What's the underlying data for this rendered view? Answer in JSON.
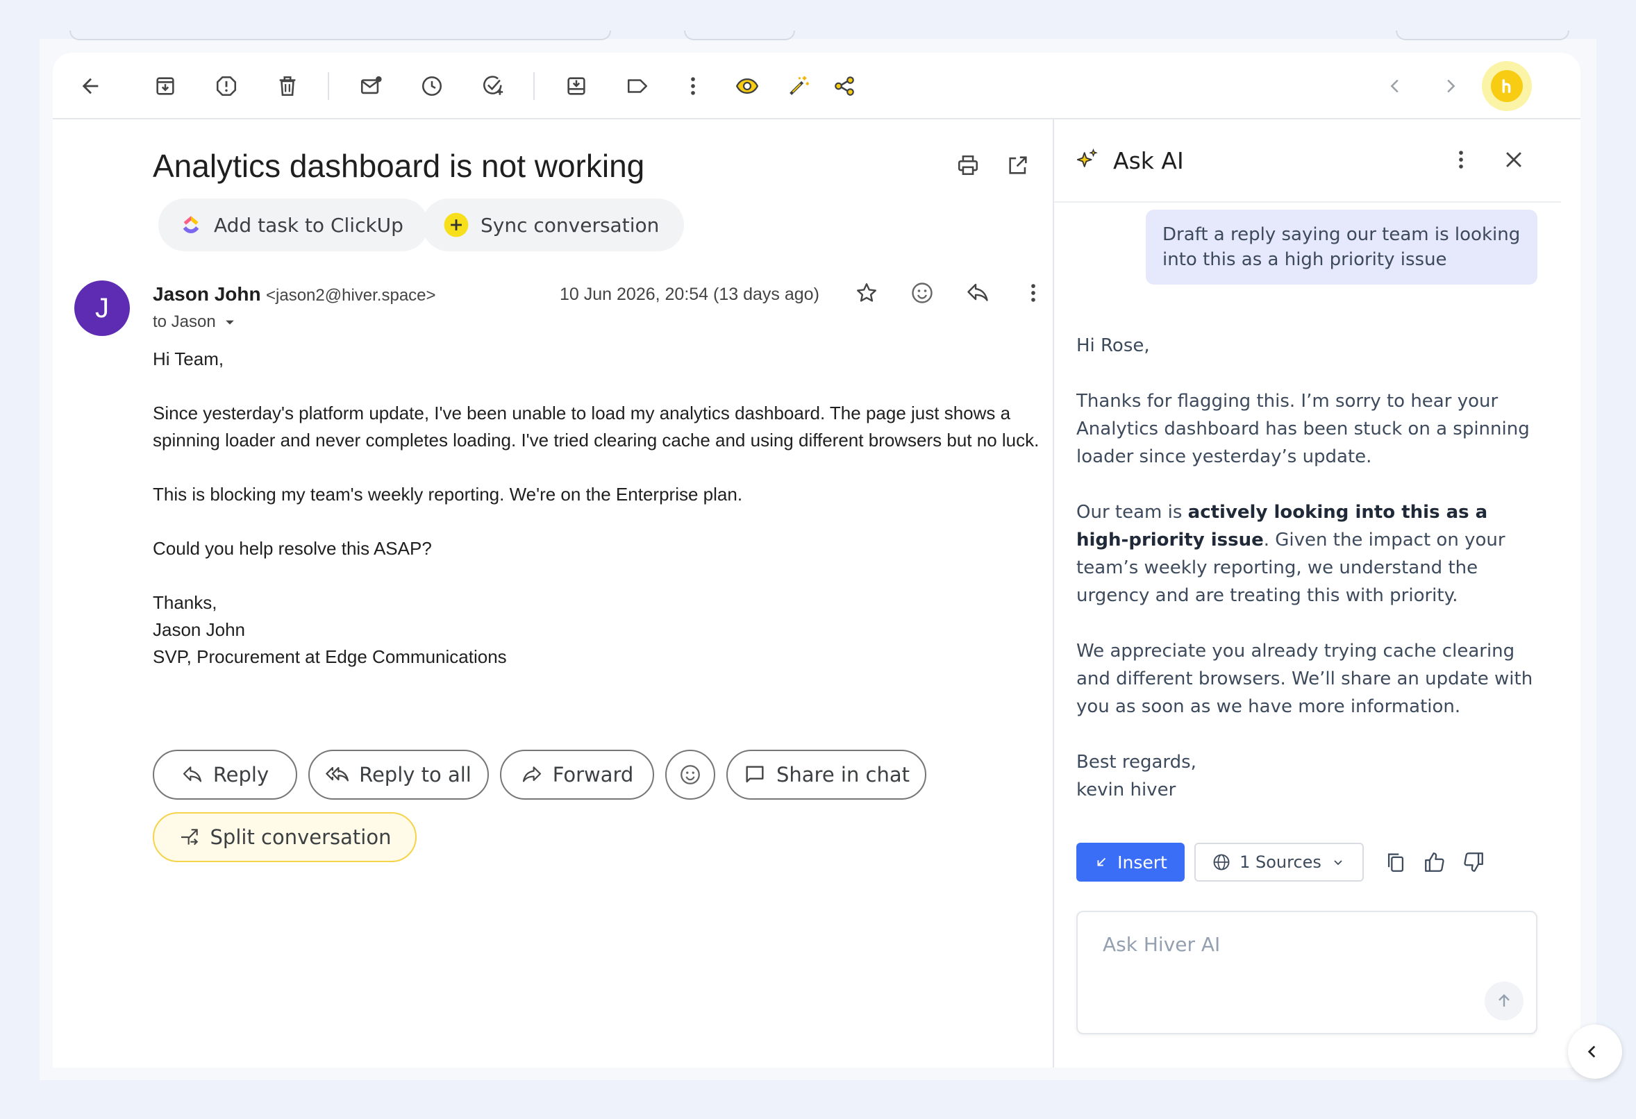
{
  "toolbar": {
    "icons": [
      "back-arrow-icon",
      "archive-icon",
      "report-spam-icon",
      "delete-icon",
      "mark-unread-icon",
      "snooze-icon",
      "add-task-icon",
      "move-to-icon",
      "label-icon",
      "more-vert-icon",
      "eye-icon",
      "magic-wand-icon",
      "share-icon"
    ],
    "nav": [
      "prev-icon",
      "next-icon"
    ]
  },
  "email": {
    "subject": "Analytics dashboard is not working",
    "chips": {
      "clickup": "Add task to ClickUp",
      "sync": "Sync conversation"
    },
    "avatar_letter": "J",
    "sender_name": "Jason John",
    "sender_email": "<jason2@hiver.space>",
    "to": "to Jason",
    "date": "10 Jun 2026, 20:54 (13 days ago)",
    "body": {
      "greeting": "Hi Team,",
      "p1": "Since yesterday's platform update, I've been unable to load my analytics dashboard. The page just shows a spinning loader and never completes loading. I've tried clearing cache and using different browsers but no luck.",
      "p2": "This is blocking my team's weekly reporting. We're on the Enterprise plan.",
      "p3": "Could you help resolve this ASAP?",
      "sign_thanks": "Thanks,",
      "sign_name": "Jason John",
      "sign_title": "SVP, Procurement at Edge Communications"
    },
    "actions": {
      "reply": "Reply",
      "reply_all": "Reply to all",
      "forward": "Forward",
      "share_chat": "Share in chat",
      "split": "Split conversation"
    }
  },
  "ai_panel": {
    "title": "Ask AI",
    "user_prompt": "Draft a reply saying our team is looking into this as a high priority issue",
    "reply": {
      "greeting": "Hi Rose,",
      "p1": "Thanks for flagging this. I’m sorry to hear your Analytics dashboard has been stuck on a spinning loader since yesterday’s update.",
      "p2_pre": "Our team is ",
      "p2_bold": "actively looking into this as a high-priority issue",
      "p2_post": ". Given the impact on your team’s weekly reporting, we understand the urgency and are treating this with priority.",
      "p3": "We appreciate you already trying cache clearing and different browsers. We’ll share an update with you as soon as we have more information.",
      "sign_off": "Best regards,",
      "sign_name": "kevin hiver"
    },
    "insert_label": "Insert",
    "sources_label": "1 Sources",
    "input_placeholder": "Ask Hiver AI"
  },
  "colors": {
    "accent_blue": "#3b6ef6",
    "avatar_purple": "#5e2cb3",
    "hiver_yellow": "#f7cc12",
    "prompt_bubble": "#e6e8fc"
  }
}
